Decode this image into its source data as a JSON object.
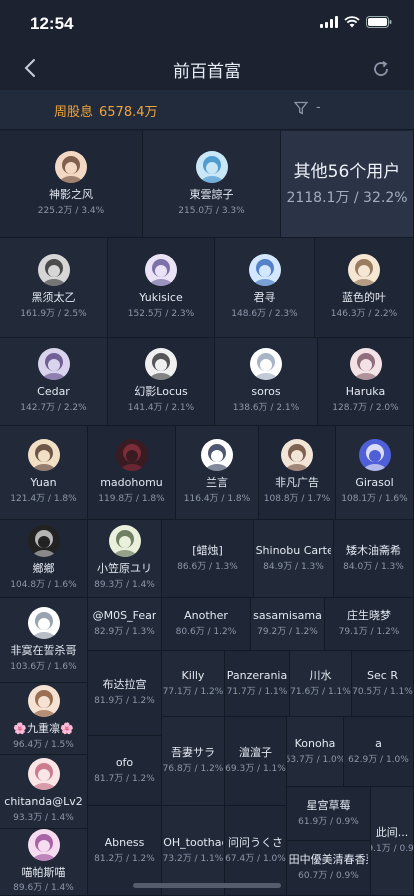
{
  "status_bar": {
    "time": "12:54"
  },
  "nav": {
    "title": "前百首富"
  },
  "summary": {
    "label": "周股息",
    "value": "6578.4万",
    "filter_text": "-"
  },
  "colors": {
    "background": "#1c2230",
    "accent": "#f0a43a",
    "highlight_cell": "#2b3446",
    "cell_a": "#1f2636",
    "cell_b": "#222a3a"
  },
  "users": [
    {
      "name": "神影之风",
      "stat": "225.2万 / 3.4%",
      "avatar": "anime-girl-avatar"
    },
    {
      "name": "東雲諒子",
      "stat": "215.0万 / 3.3%",
      "avatar": "anime-girl-avatar"
    },
    {
      "name": "其他56个用户",
      "stat": "2118.1万 / 32.2%"
    },
    {
      "name": "黑须太乙",
      "stat": "161.9万 / 2.5%",
      "avatar": "anime-girl-avatar"
    },
    {
      "name": "Yukisice",
      "stat": "152.5万 / 2.3%",
      "avatar": "anime-girl-avatar"
    },
    {
      "name": "君寻",
      "stat": "148.6万 / 2.3%",
      "avatar": "anime-girl-avatar"
    },
    {
      "name": "蓝色的叶",
      "stat": "146.3万 / 2.2%",
      "avatar": "anime-girl-avatar"
    },
    {
      "name": "Cedar",
      "stat": "142.7万 / 2.2%",
      "avatar": "anime-girl-avatar"
    },
    {
      "name": "幻影Locus",
      "stat": "141.4万 / 2.1%",
      "avatar": "anime-girl-avatar"
    },
    {
      "name": "soros",
      "stat": "138.6万 / 2.1%",
      "avatar": "sketch-avatar"
    },
    {
      "name": "Haruka",
      "stat": "128.7万 / 2.0%",
      "avatar": "anime-girl-avatar"
    },
    {
      "name": "Yuan",
      "stat": "121.4万 / 1.8%",
      "avatar": "anime-girl-avatar"
    },
    {
      "name": "madohomu",
      "stat": "119.8万 / 1.8%",
      "avatar": "rose-avatar"
    },
    {
      "name": "兰言",
      "stat": "116.4万 / 1.8%",
      "avatar": "anime-girl-avatar"
    },
    {
      "name": "非凡广告",
      "stat": "108.8万 / 1.7%",
      "avatar": "anime-girl-avatar"
    },
    {
      "name": "Girasol",
      "stat": "108.1万 / 1.6%",
      "avatar": "cat-avatar"
    },
    {
      "name": "鄉鄉",
      "stat": "104.8万 / 1.6%",
      "avatar": "anime-girl-avatar"
    },
    {
      "name": "小笠原ユリ",
      "stat": "89.3万 / 1.4%",
      "avatar": "anime-girl-avatar"
    },
    {
      "name": "[蜡烛]",
      "stat": "86.6万 / 1.3%"
    },
    {
      "name": "Shinobu Carter",
      "stat": "84.9万 / 1.3%"
    },
    {
      "name": "矮木油斋希",
      "stat": "84.0万 / 1.3%"
    },
    {
      "name": "@M0S_Fear",
      "stat": "82.9万 / 1.3%"
    },
    {
      "name": "Another",
      "stat": "80.6万 / 1.2%"
    },
    {
      "name": "sasamisama",
      "stat": "79.2万 / 1.2%"
    },
    {
      "name": "庄生晓梦",
      "stat": "79.1万 / 1.2%"
    },
    {
      "name": "非寞在誓杀哥",
      "stat": "103.6万 / 1.6%",
      "avatar": "sketch-avatar"
    },
    {
      "name": "布达拉宫",
      "stat": "81.9万 / 1.2%"
    },
    {
      "name": "Killy",
      "stat": "77.1万 / 1.2%"
    },
    {
      "name": "Panzerania",
      "stat": "71.7万 / 1.1%"
    },
    {
      "name": "川水",
      "stat": "71.6万 / 1.1%"
    },
    {
      "name": "Sec R",
      "stat": "70.5万 / 1.1%"
    },
    {
      "name": "🌸九重凛🌸",
      "stat": "96.4万 / 1.5%",
      "avatar": "anime-girl-avatar"
    },
    {
      "name": "ofo",
      "stat": "81.7万 / 1.2%"
    },
    {
      "name": "吾妻サラ",
      "stat": "76.8万 / 1.2%"
    },
    {
      "name": "澶澶子",
      "stat": "69.3万 / 1.1%"
    },
    {
      "name": "Konoha",
      "stat": "63.7万 / 1.0%"
    },
    {
      "name": "a",
      "stat": "62.9万 / 1.0%"
    },
    {
      "name": "chitanda@Lv2",
      "stat": "93.3万 / 1.4%",
      "avatar": "anime-girl-avatar"
    },
    {
      "name": "星宫草莓",
      "stat": "61.9万 / 0.9%"
    },
    {
      "name": "喵帕斯喵",
      "stat": "89.6万 / 1.4%",
      "avatar": "anime-girl-avatar"
    },
    {
      "name": "Abness",
      "stat": "81.2万 / 1.2%"
    },
    {
      "name": "OH_toothache",
      "stat": "73.2万 / 1.1%"
    },
    {
      "name": "问问うくさ",
      "stat": "67.4万 / 1.0%"
    },
    {
      "name": "此间...",
      "stat": "59.1万 / 0.9%"
    },
    {
      "name": "田中優美清春香菜",
      "stat": "60.7万 / 0.9%"
    }
  ]
}
